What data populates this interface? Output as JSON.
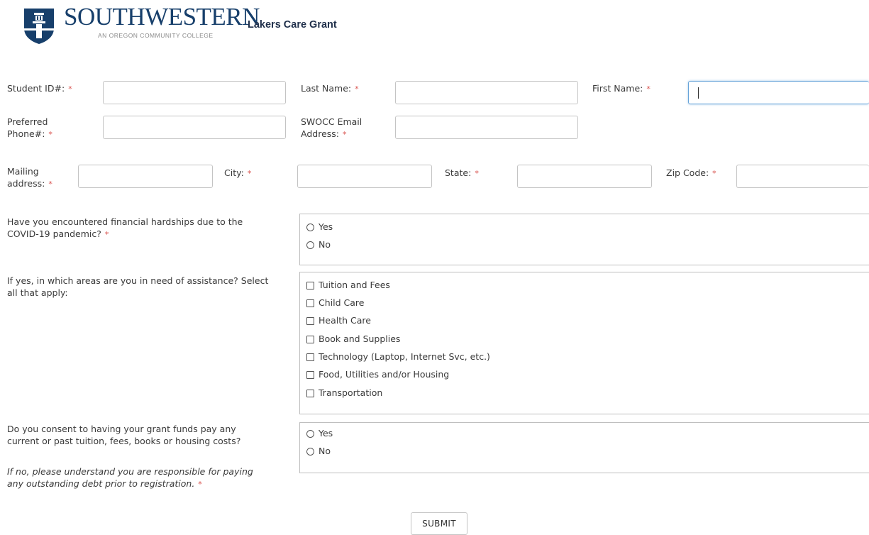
{
  "header": {
    "brand_name": "SOUTHWESTERN",
    "brand_sub": "AN OREGON COMMUNITY COLLEGE",
    "app_title": "Lakers Care Grant",
    "brand_color": "#173f6b",
    "logo_icon": "lighthouse-shield-icon"
  },
  "required_marker": "*",
  "labels": {
    "student_id": "Student ID#:",
    "last_name": "Last Name:",
    "first_name": "First Name:",
    "phone_1": "Preferred",
    "phone_2": "Phone#:",
    "email_1": "SWOCC Email",
    "email_2": "Address:",
    "mailing_1": "Mailing",
    "mailing_2": "address:",
    "city": "City:",
    "state": "State:",
    "zip": "Zip Code:"
  },
  "fields": {
    "student_id": "",
    "last_name": "",
    "first_name": "",
    "phone": "",
    "email": "",
    "mailing": "",
    "city": "",
    "state": "",
    "zip": ""
  },
  "questions": {
    "hardship": {
      "line1": "Have you encountered financial hardships due to the",
      "line2": "COVID-19 pandemic?",
      "options": [
        "Yes",
        "No"
      ]
    },
    "assistance": {
      "line1": "If yes, in which areas are you in need of assistance?  Select",
      "line2": "all that apply:",
      "options": [
        "Tuition and Fees",
        "Child Care",
        "Health Care",
        "Book and Supplies",
        "Technology (Laptop, Internet Svc, etc.)",
        "Food, Utilities and/or Housing",
        "Transportation"
      ]
    },
    "consent": {
      "line1": "Do you consent to having your grant funds pay any",
      "line2": "current or past tuition, fees, books or housing costs?",
      "note1": "If no, please understand you are responsible for paying",
      "note2": "any outstanding debt prior to registration.",
      "options": [
        "Yes",
        "No"
      ]
    }
  },
  "submit_label": "SUBMIT",
  "colors": {
    "required": "#d9534f",
    "focus": "#66a3d9"
  }
}
